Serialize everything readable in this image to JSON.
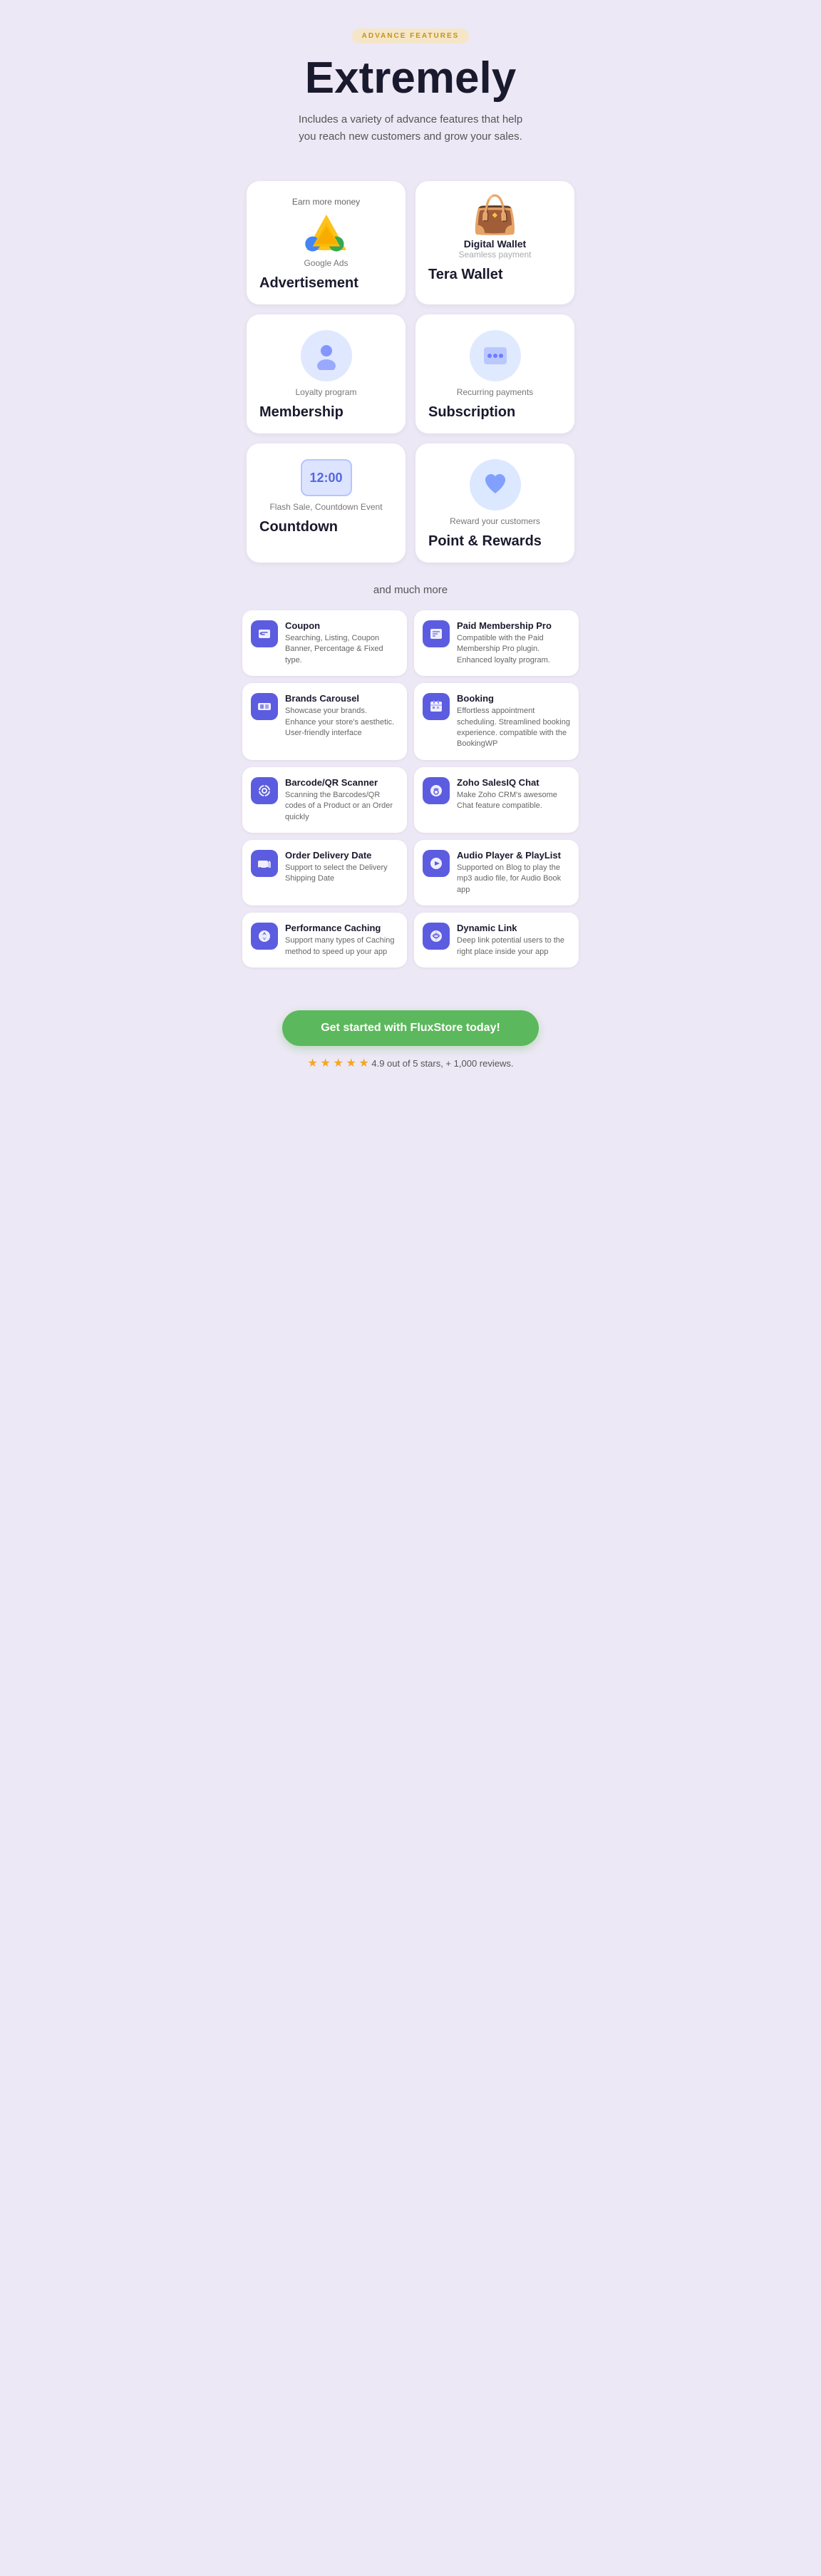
{
  "header": {
    "badge": "ADVANCE FEATURES",
    "title": "Extremely",
    "subtitle": "Includes a variety of advance features that help you reach new customers and grow your sales."
  },
  "cards": [
    {
      "id": "advertisement",
      "top_label": "Earn more money",
      "icon_type": "google-ads",
      "secondary_label": "Google Ads",
      "title": "Advertisement"
    },
    {
      "id": "tera-wallet",
      "top_label": "",
      "icon_type": "wallet",
      "secondary_label": "Digital Wallet",
      "sub_secondary": "Seamless payment",
      "title": "Tera Wallet"
    },
    {
      "id": "membership",
      "top_label": "",
      "icon_type": "member",
      "secondary_label": "Loyalty program",
      "title": "Membership"
    },
    {
      "id": "subscription",
      "top_label": "",
      "icon_type": "subscription",
      "secondary_label": "Recurring payments",
      "title": "Subscription"
    },
    {
      "id": "countdown",
      "top_label": "",
      "icon_type": "countdown",
      "secondary_label": "Flash Sale, Countdown Event",
      "title": "Countdown"
    },
    {
      "id": "point-rewards",
      "top_label": "",
      "icon_type": "heart",
      "secondary_label": "Reward your customers",
      "title": "Point & Rewards"
    }
  ],
  "much_more": "and much more",
  "list_items": [
    {
      "icon": "🏷",
      "title": "Coupon",
      "desc": "Searching, Listing, Coupon Banner, Percentage & Fixed type."
    },
    {
      "icon": "👤",
      "title": "Paid Membership Pro",
      "desc": "Compatible with the Paid Membership Pro plugin. Enhanced loyalty program."
    },
    {
      "icon": "📺",
      "title": "Brands Carousel",
      "desc": "Showcase your brands. Enhance your store's aesthetic. User-friendly interface"
    },
    {
      "icon": "🗓",
      "title": "Booking",
      "desc": "Effortless appointment scheduling. Streamlined booking experience. compatible with the BookingWP"
    },
    {
      "icon": "📷",
      "title": "Barcode/QR Scanner",
      "desc": "Scanning the Barcodes/QR codes of a Product or an Order quickly"
    },
    {
      "icon": "💬",
      "title": "Zoho SalesIQ Chat",
      "desc": "Make Zoho CRM's awesome Chat feature compatible."
    },
    {
      "icon": "📦",
      "title": "Order Delivery Date",
      "desc": "Support to select the Delivery Shipping Date"
    },
    {
      "icon": "🎵",
      "title": "Audio Player & PlayList",
      "desc": "Supported on Blog to play the mp3 audio file, for Audio Book app"
    },
    {
      "icon": "⚡",
      "title": "Performance Caching",
      "desc": "Support many types of Caching method to speed up your app"
    },
    {
      "icon": "🔗",
      "title": "Dynamic Link",
      "desc": "Deep link potential users to the right place inside your app"
    }
  ],
  "cta": {
    "button_label": "Get started with FluxStore today!",
    "rating_text": "4.9 out of 5 stars, + 1,000 reviews."
  }
}
